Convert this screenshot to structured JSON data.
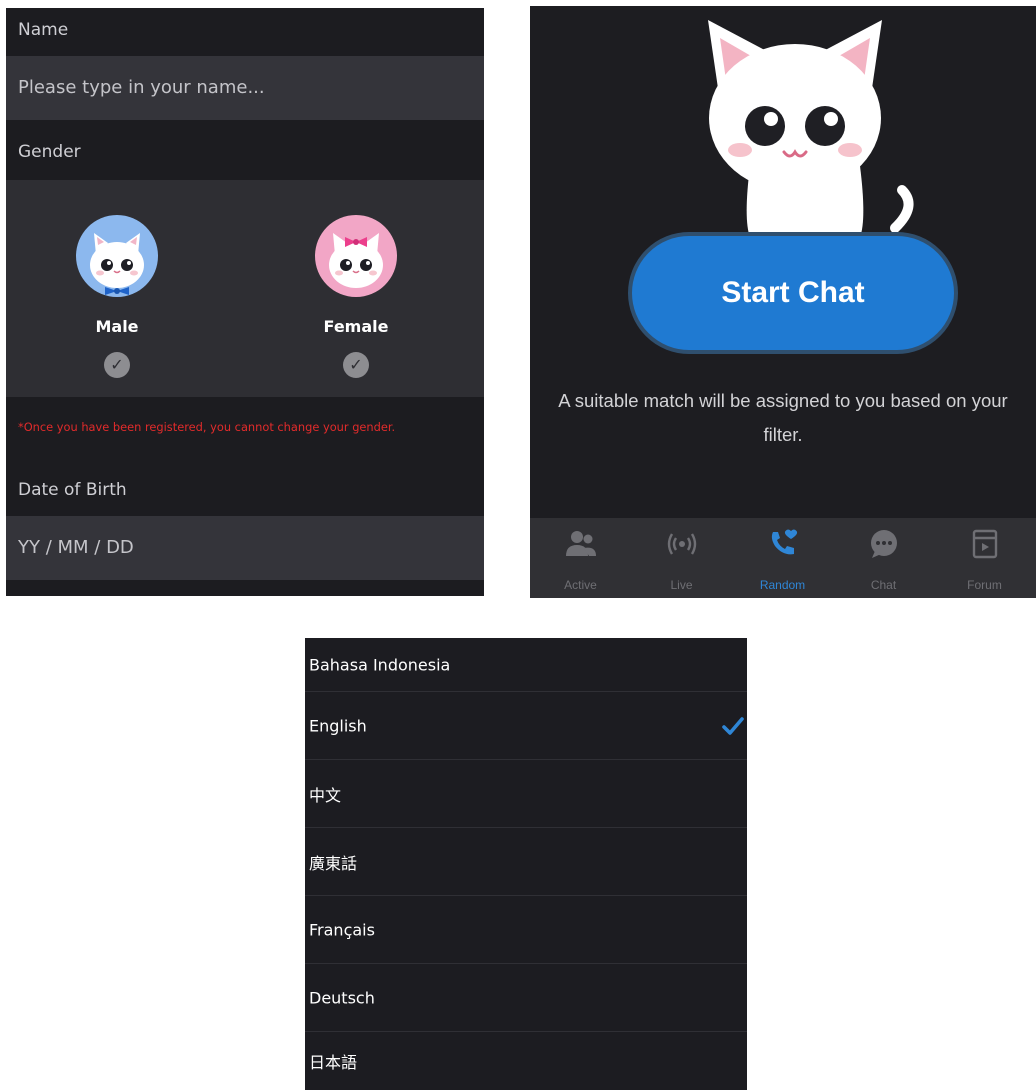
{
  "registration": {
    "name_label": "Name",
    "name_placeholder": "Please type in your name...",
    "gender_label": "Gender",
    "male_label": "Male",
    "female_label": "Female",
    "gender_warning": "*Once you have been registered, you cannot change your gender.",
    "dob_label": "Date of Birth",
    "dob_placeholder": "YY / MM / DD"
  },
  "random_chat": {
    "start_button": "Start Chat",
    "match_text_line1": "A suitable match will be assigned to you based on your",
    "match_text_line2": "filter.",
    "nav": [
      {
        "label": "Active",
        "icon": "people-icon"
      },
      {
        "label": "Live",
        "icon": "broadcast-icon"
      },
      {
        "label": "Random",
        "icon": "phone-heart-icon",
        "active": true
      },
      {
        "label": "Chat",
        "icon": "chat-bubble-icon"
      },
      {
        "label": "Forum",
        "icon": "forum-icon"
      }
    ]
  },
  "languages": {
    "items": [
      {
        "label": "Bahasa Indonesia",
        "selected": false
      },
      {
        "label": "English",
        "selected": true
      },
      {
        "label": "中文",
        "selected": false
      },
      {
        "label": "廣東話",
        "selected": false
      },
      {
        "label": "Français",
        "selected": false
      },
      {
        "label": "Deutsch",
        "selected": false
      },
      {
        "label": "日本語",
        "selected": false
      }
    ]
  },
  "colors": {
    "accent": "#1f7ad2",
    "background": "#1c1c20",
    "field": "#34343a",
    "warning": "#e12b2b",
    "male_avatar_bg": "#8cb8ee",
    "female_avatar_bg": "#f2a6c6"
  }
}
